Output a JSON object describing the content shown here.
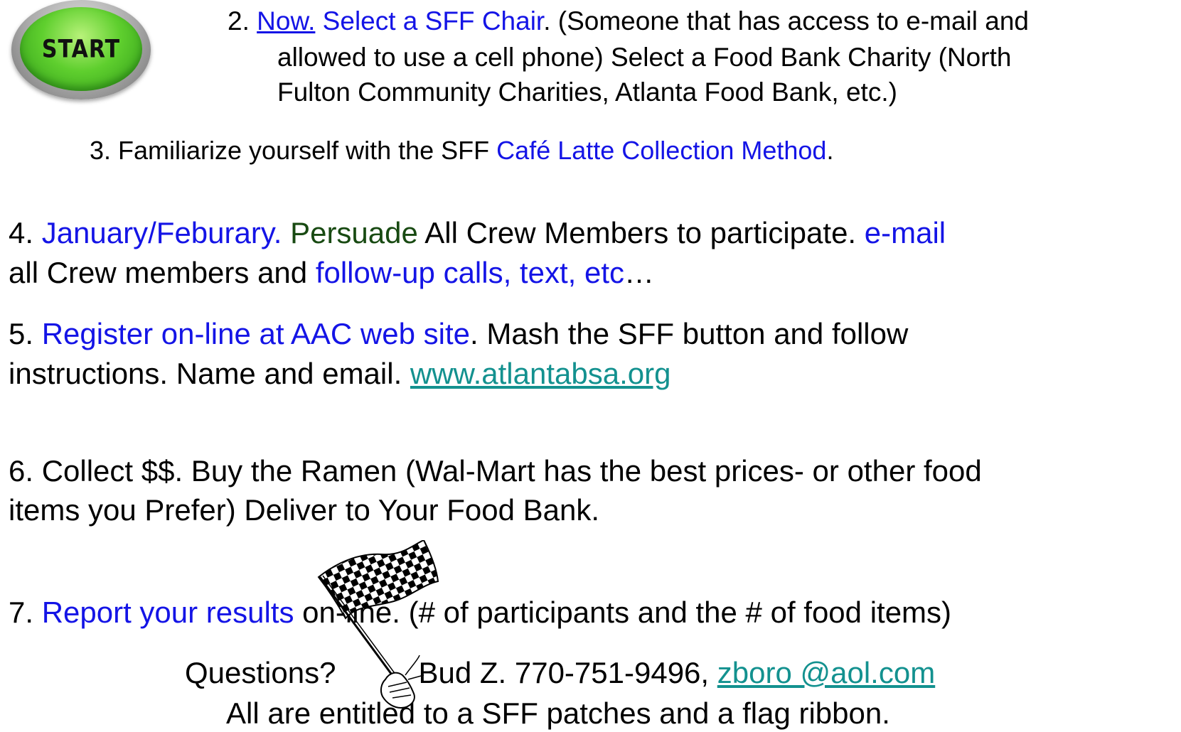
{
  "start_button": {
    "label": "START",
    "icon": "start-button-icon"
  },
  "step2": {
    "num": "2.  ",
    "now": "Now.",
    "select_chair": " Select a SFF Chair",
    "rest1": ". (Someone that has access to e-mail and",
    "line2": "allowed to use a cell phone)  Select a Food Bank Charity (North",
    "line3": "Fulton Community Charities, Atlanta Food Bank, etc.)"
  },
  "step3": {
    "pre": "3. Familiarize yourself with the SFF ",
    "method": "Café Latte Collection Method",
    "post": "."
  },
  "step4": {
    "num": "4. ",
    "when": "January/Feburary.",
    "persuade": " Persuade",
    "mid": " All Crew Members to participate. ",
    "email": "e-mail",
    "line2_pre": "all Crew members and ",
    "followup": "follow-up calls, text, etc",
    "ellipsis": "…"
  },
  "step5": {
    "num": "5. ",
    "register": "Register on-line at AAC web site",
    "rest": ".  Mash the SFF button and follow",
    "line2_pre": "instructions. Name and email. ",
    "url": "www.atlantabsa.org"
  },
  "step6": {
    "line1": "6. Collect $$. Buy the Ramen (Wal-Mart has the best prices- or other food",
    "line2": "items you Prefer) Deliver to Your Food Bank."
  },
  "step7": {
    "num": "7. ",
    "report": "Report your results",
    "rest": " on-line. (# of participants and the # of food items)"
  },
  "questions": {
    "pre": "Questions?",
    "contact": "Bud Z. 770-751-9496, ",
    "email": "zboro @aol.com"
  },
  "closing": "All are entitled to a SFF patches and a flag ribbon.",
  "flag": {
    "icon": "checkered-flag-icon"
  },
  "colors": {
    "link_blue": "#1414e6",
    "dark_green": "#184a12",
    "teal_link": "#13918f"
  }
}
